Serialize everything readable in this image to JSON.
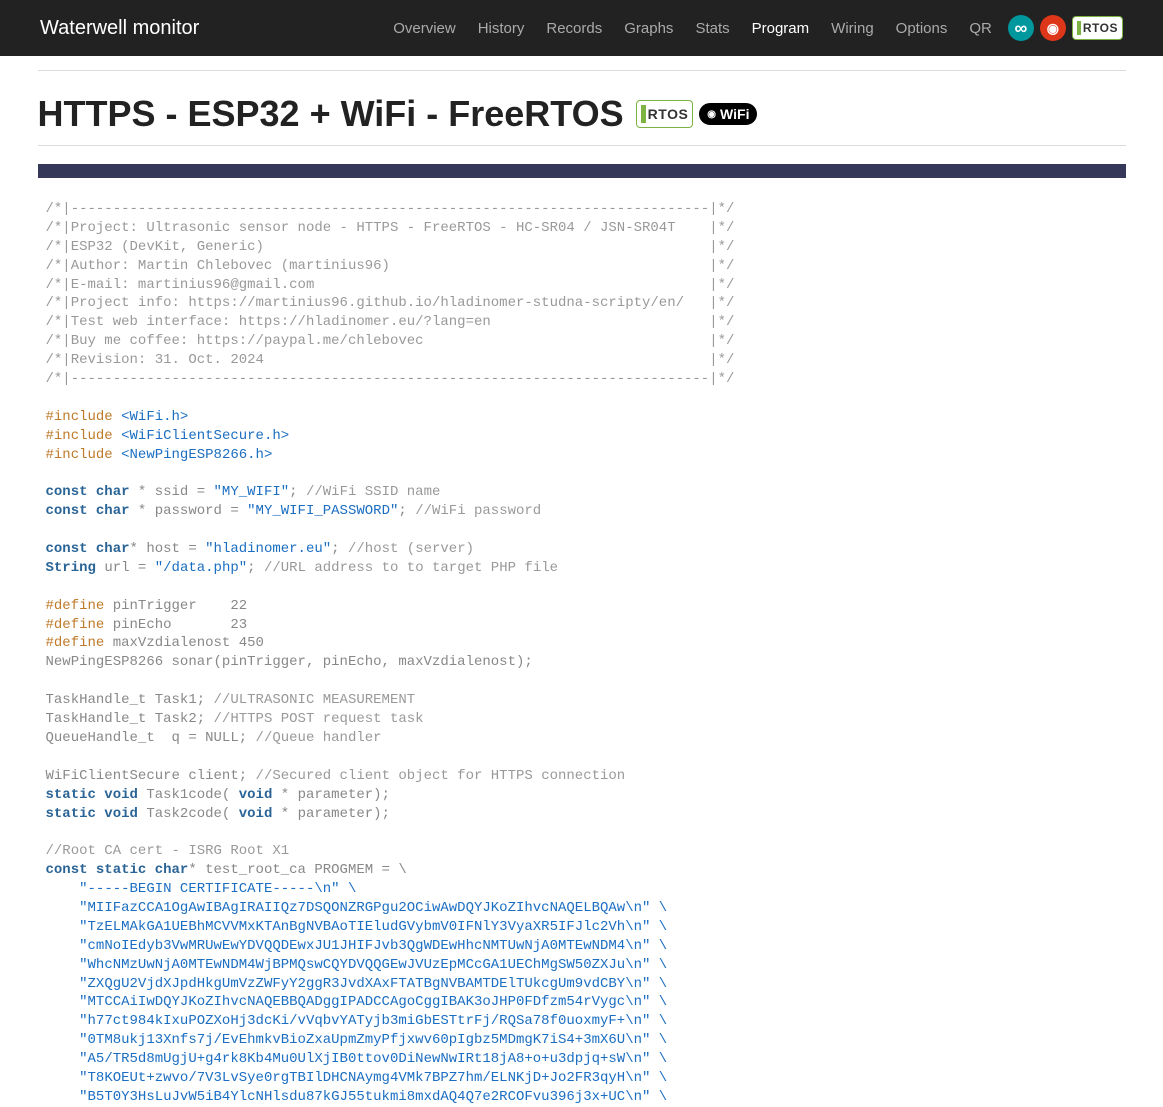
{
  "header": {
    "brand": "Waterwell monitor",
    "nav": [
      {
        "label": "Overview",
        "active": false
      },
      {
        "label": "History",
        "active": false
      },
      {
        "label": "Records",
        "active": false
      },
      {
        "label": "Graphs",
        "active": false
      },
      {
        "label": "Stats",
        "active": false
      },
      {
        "label": "Program",
        "active": true
      },
      {
        "label": "Wiring",
        "active": false
      },
      {
        "label": "Options",
        "active": false
      },
      {
        "label": "QR",
        "active": false
      }
    ],
    "icons": [
      "arduino-icon",
      "wifi-icon",
      "freertos-badge"
    ],
    "rtos_text": "RTOS"
  },
  "title": {
    "text": "HTTPS - ESP32 + WiFi - FreeRTOS",
    "rtos_text": "RTOS",
    "wifi_text": "WiFi"
  },
  "code": {
    "header_comment": [
      "/*|----------------------------------------------------------------------------|*/",
      "/*|Project: Ultrasonic sensor node - HTTPS - FreeRTOS - HC-SR04 / JSN-SR04T    |*/",
      "/*|ESP32 (DevKit, Generic)                                                     |*/",
      "/*|Author: Martin Chlebovec (martinius96)                                      |*/",
      "/*|E-mail: martinius96@gmail.com                                               |*/",
      "/*|Project info: https://martinius96.github.io/hladinomer-studna-scripty/en/   |*/",
      "/*|Test web interface: https://hladinomer.eu/?lang=en                          |*/",
      "/*|Buy me coffee: https://paypal.me/chlebovec                                  |*/",
      "/*|Revision: 31. Oct. 2024                                                     |*/",
      "/*|----------------------------------------------------------------------------|*/"
    ],
    "includes": [
      {
        "pre": "#include",
        "val": "<WiFi.h>"
      },
      {
        "pre": "#include",
        "val": "<WiFiClientSecure.h>"
      },
      {
        "pre": "#include",
        "val": "<NewPingESP8266.h>"
      }
    ],
    "consts": [
      {
        "kw": "const char",
        "id": " * ssid = ",
        "str": "\"MY_WIFI\"",
        "tail": "; ",
        "cm": "//WiFi SSID name"
      },
      {
        "kw": "const char",
        "id": " * password = ",
        "str": "\"MY_WIFI_PASSWORD\"",
        "tail": "; ",
        "cm": "//WiFi password"
      }
    ],
    "host_line": {
      "kw": "const char",
      "id": "* host = ",
      "str": "\"hladinomer.eu\"",
      "tail": "; ",
      "cm": "//host (server)"
    },
    "url_line": {
      "kw": "String",
      "id": " url = ",
      "str": "\"/data.php\"",
      "tail": "; ",
      "cm": "//URL address to to target PHP file"
    },
    "defines": [
      {
        "pre": "#define",
        "id": " pinTrigger    22"
      },
      {
        "pre": "#define",
        "id": " pinEcho       23"
      },
      {
        "pre": "#define",
        "id": " maxVzdialenost 450"
      }
    ],
    "sonar_line": "NewPingESP8266 sonar(pinTrigger, pinEcho, maxVzdialenost);",
    "task_lines": [
      {
        "txt": "TaskHandle_t Task1; ",
        "cm": "//ULTRASONIC MEASUREMENT"
      },
      {
        "txt": "TaskHandle_t Task2; ",
        "cm": "//HTTPS POST request task"
      },
      {
        "txt": "QueueHandle_t  q = NULL; ",
        "cm": "//Queue handler"
      }
    ],
    "client_line": {
      "txt": "WiFiClientSecure client; ",
      "cm": "//Secured client object for HTTPS connection"
    },
    "proto_lines": [
      {
        "kw1": "static void",
        "mid": " Task1code( ",
        "kw2": "void",
        "tail": " * parameter);"
      },
      {
        "kw1": "static void",
        "mid": " Task2code( ",
        "kw2": "void",
        "tail": " * parameter);"
      }
    ],
    "cert_comment": "//Root CA cert - ISRG Root X1",
    "cert_decl": {
      "kw": "const static char",
      "id": "* test_root_ca PROGMEM = \\"
    },
    "cert_lines": [
      "\"-----BEGIN CERTIFICATE-----\\n\" \\",
      "\"MIIFazCCA1OgAwIBAgIRAIIQz7DSQONZRGPgu2OCiwAwDQYJKoZIhvcNAQELBQAw\\n\" \\",
      "\"TzELMAkGA1UEBhMCVVMxKTAnBgNVBAoTIEludGVybmV0IFNlY3VyaXR5IFJlc2Vh\\n\" \\",
      "\"cmNoIEdyb3VwMRUwEwYDVQQDEwxJU1JHIFJvb3QgWDEwHhcNMTUwNjA0MTEwNDM4\\n\" \\",
      "\"WhcNMzUwNjA0MTEwNDM4WjBPMQswCQYDVQQGEwJVUzEpMCcGA1UEChMgSW50ZXJu\\n\" \\",
      "\"ZXQgU2VjdXJpdHkgUmVzZWFyY2ggR3JvdXAxFTATBgNVBAMTDElTUkcgUm9vdCBY\\n\" \\",
      "\"MTCCAiIwDQYJKoZIhvcNAQEBBQADggIPADCCAgoCggIBAK3oJHP0FDfzm54rVygc\\n\" \\",
      "\"h77ct984kIxuPOZXoHj3dcKi/vVqbvYATyjb3miGbESTtrFj/RQSa78f0uoxmyF+\\n\" \\",
      "\"0TM8ukj13Xnfs7j/EvEhmkvBioZxaUpmZmyPfjxwv60pIgbz5MDmgK7iS4+3mX6U\\n\" \\",
      "\"A5/TR5d8mUgjU+g4rk8Kb4Mu0UlXjIB0ttov0DiNewNwIRt18jA8+o+u3dpjq+sW\\n\" \\",
      "\"T8KOEUt+zwvo/7V3LvSye0rgTBIlDHCNAymg4VMk7BPZ7hm/ELNKjD+Jo2FR3qyH\\n\" \\",
      "\"B5T0Y3HsLuJvW5iB4YlcNHlsdu87kGJ55tukmi8mxdAQ4Q7e2RCOFvu396j3x+UC\\n\" \\"
    ],
    "indent": "    "
  }
}
